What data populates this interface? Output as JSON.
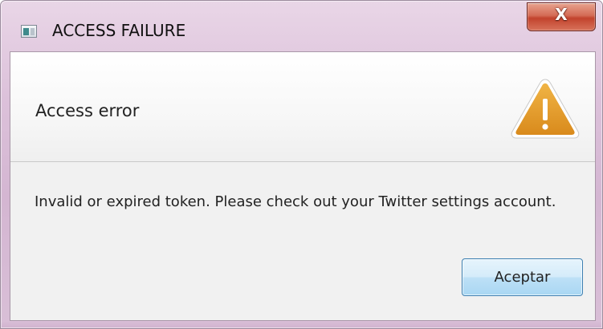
{
  "window": {
    "title": "ACCESS FAILURE",
    "close_glyph": "X"
  },
  "header": {
    "title": "Access error",
    "icon": "warning-triangle-icon",
    "icon_color": "#e09a2a"
  },
  "message": {
    "text": "Invalid or expired token. Please check out your Twitter settings account."
  },
  "buttons": {
    "ok_label": "Aceptar"
  }
}
